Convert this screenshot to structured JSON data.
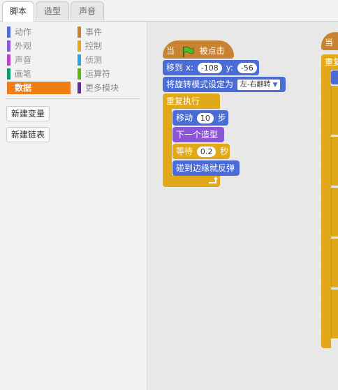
{
  "tabs": [
    {
      "label": "脚本",
      "active": true
    },
    {
      "label": "造型",
      "active": false
    },
    {
      "label": "声音",
      "active": false
    }
  ],
  "categories": {
    "left": [
      {
        "label": "动作",
        "color": "#4a6cd4"
      },
      {
        "label": "外观",
        "color": "#8a55d7"
      },
      {
        "label": "声音",
        "color": "#bb42c3"
      },
      {
        "label": "画笔",
        "color": "#0e9a6c"
      },
      {
        "label": "数据",
        "color": "#ee7d16",
        "selected": true
      }
    ],
    "right": [
      {
        "label": "事件",
        "color": "#c88330"
      },
      {
        "label": "控制",
        "color": "#e1a91a"
      },
      {
        "label": "侦测",
        "color": "#2ca5e2"
      },
      {
        "label": "运算符",
        "color": "#5cb712"
      },
      {
        "label": "更多模块",
        "color": "#632d99"
      }
    ]
  },
  "palette_buttons": {
    "new_variable": "新建变量",
    "new_list": "新建链表"
  },
  "script": {
    "hat_when": "当",
    "hat_clicked": "被点击",
    "goto_label": "移到",
    "goto_x_label": "x:",
    "goto_x": "-108",
    "goto_y_label": "y:",
    "goto_y": "-56",
    "rotation_label": "将旋转模式设定为",
    "rotation_value": "左-右翻转",
    "forever_label": "重复执行",
    "move_label": "移动",
    "move_steps": "10",
    "move_unit": "步",
    "next_costume": "下一个造型",
    "wait_label": "等待",
    "wait_value": "0.2",
    "wait_unit": "秒",
    "bounce": "碰到边缘就反弹"
  },
  "script2": {
    "hat_when": "当",
    "forever_label": "重复"
  }
}
